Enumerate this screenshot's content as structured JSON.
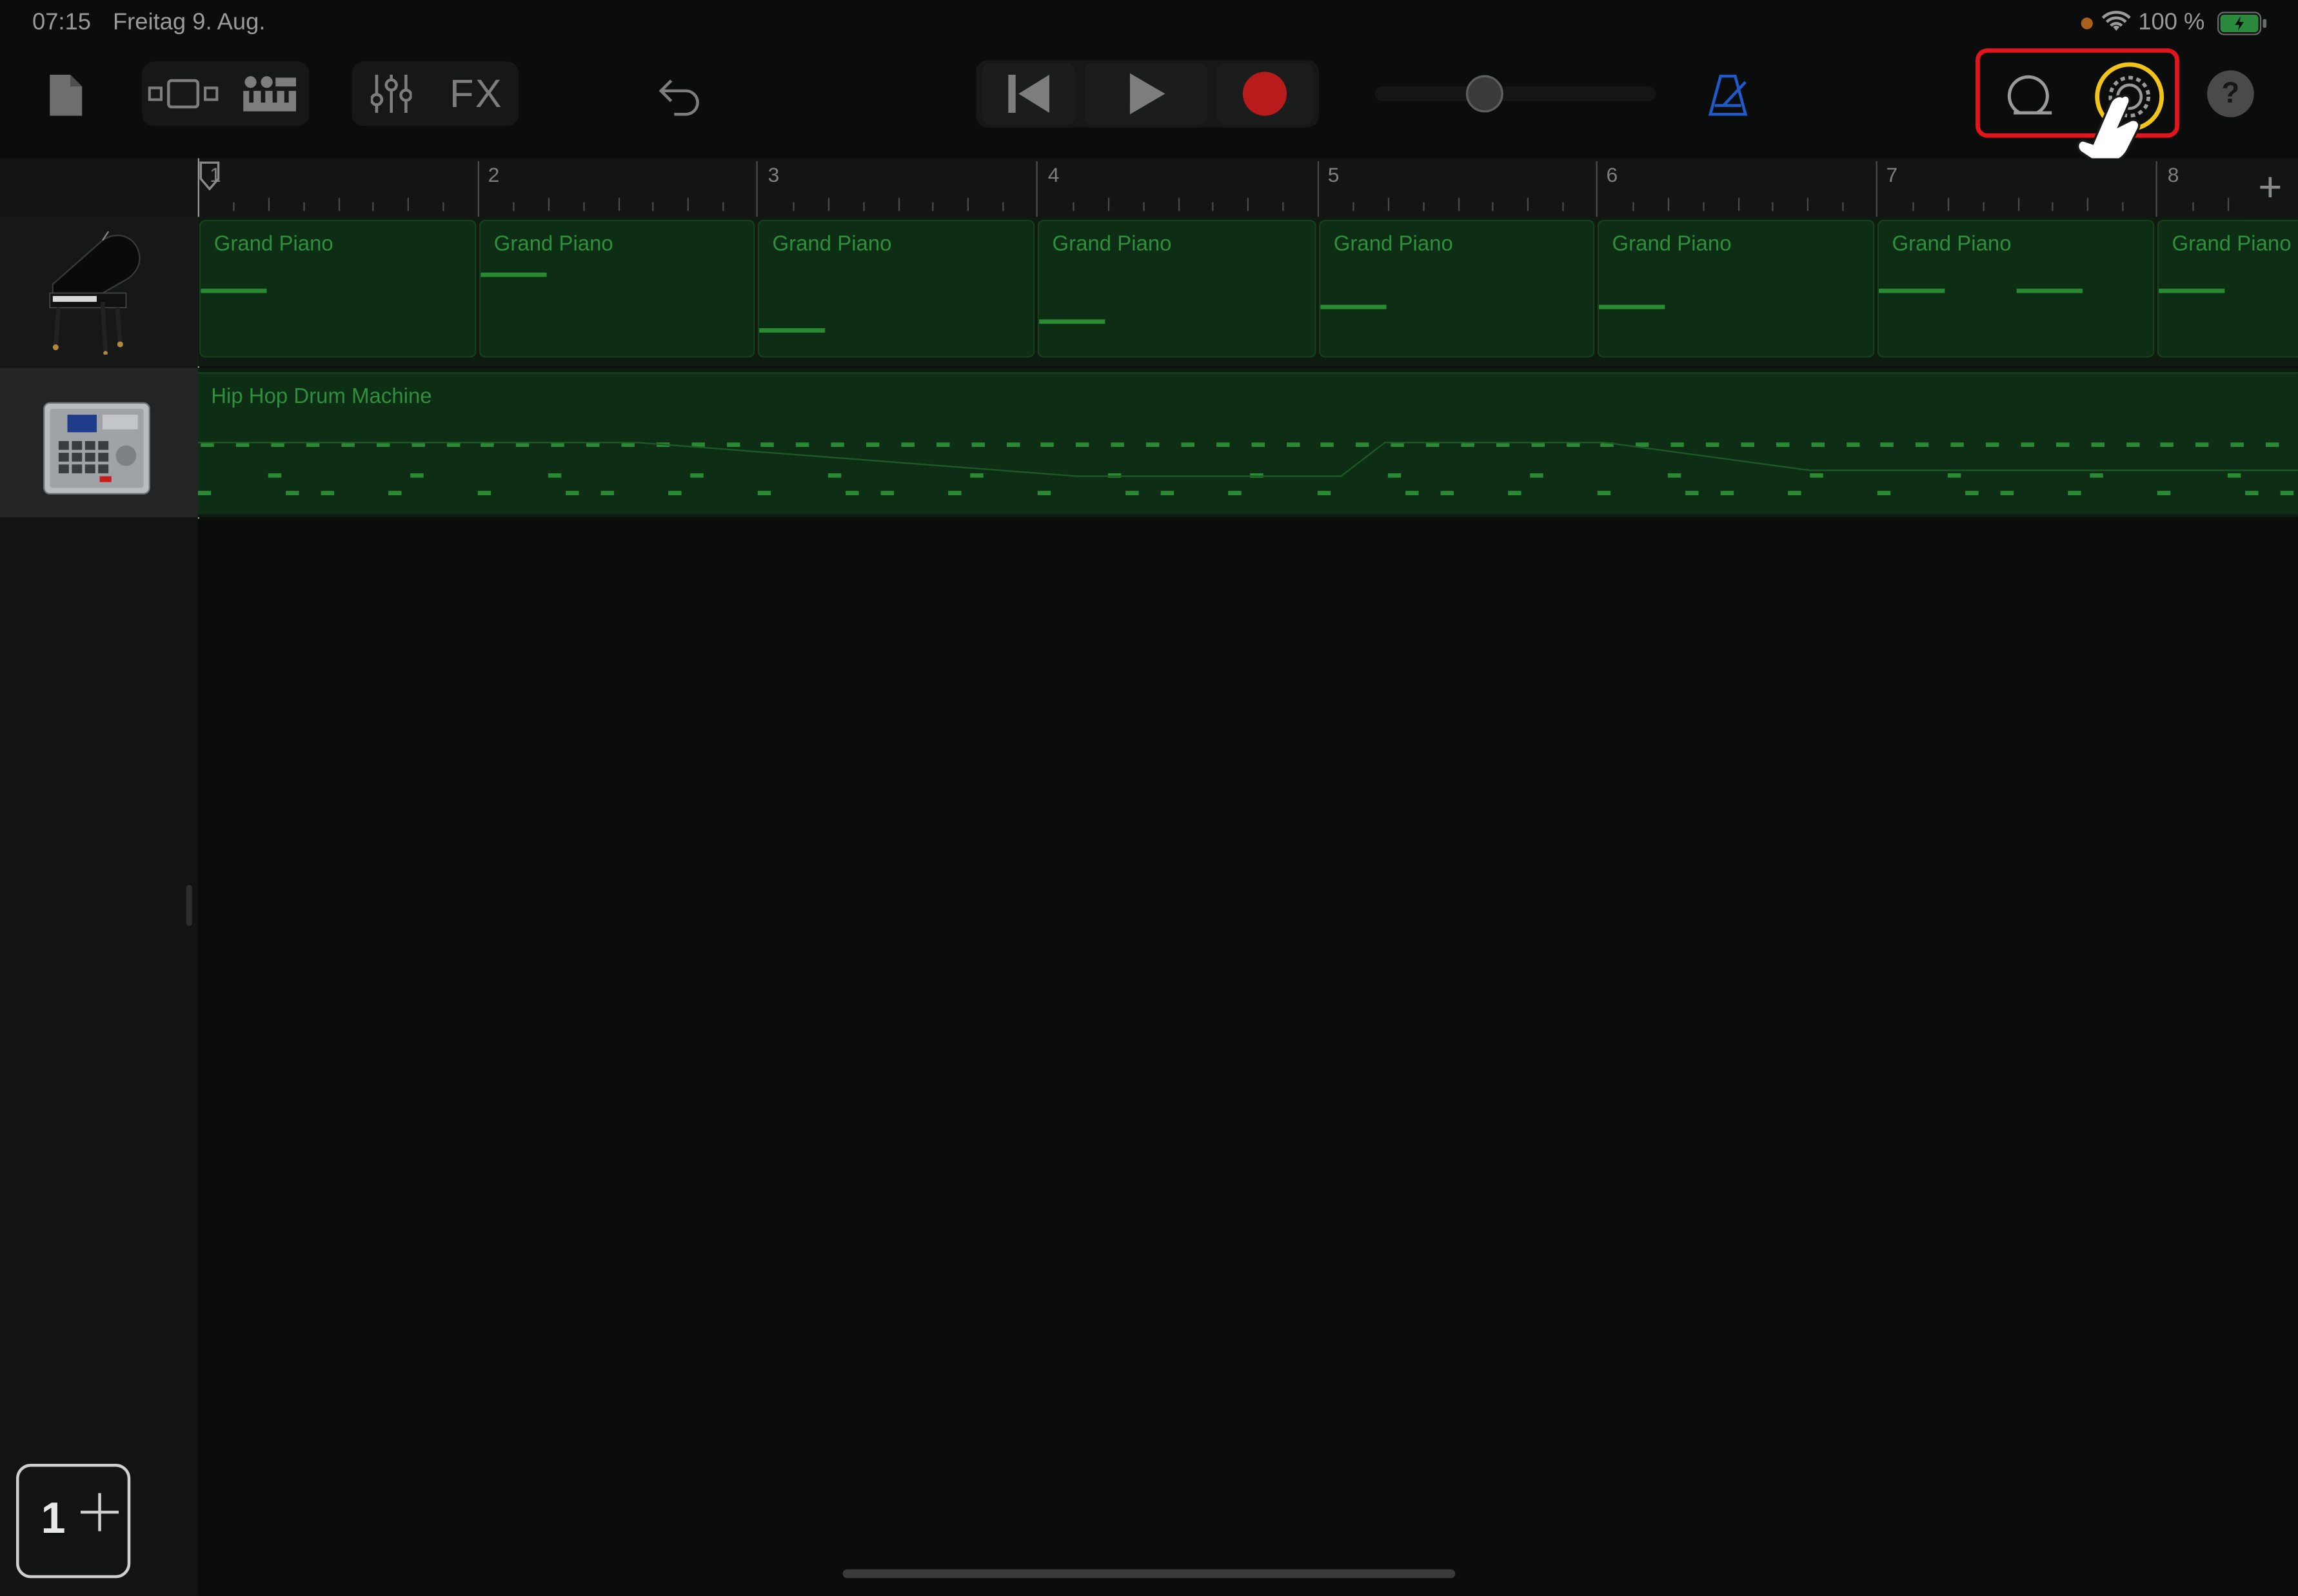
{
  "status_bar": {
    "time": "07:15",
    "date": "Freitag 9. Aug.",
    "battery": "100 %"
  },
  "toolbar": {
    "icons": [
      "document-icon",
      "view-toggle-icon",
      "keyboard-controls-icon",
      "mixer-icon",
      "undo-icon",
      "rewind-icon",
      "play-icon",
      "record-icon",
      "master-volume-slider",
      "metronome-icon",
      "loop-browser-icon",
      "settings-icon",
      "help-icon"
    ],
    "fx_label": "FX",
    "help_label": "?",
    "record_color": "#c81c1c",
    "metronome_color": "#1f5ac8",
    "settings_highlight_color": "#f0c419"
  },
  "ruler": {
    "bars": [
      "1",
      "2",
      "3",
      "4",
      "5",
      "6",
      "7",
      "8"
    ],
    "add_label": "+"
  },
  "tracks": [
    {
      "name": "Grand Piano",
      "instrument_icon": "grand-piano-icon",
      "regions": [
        "Grand Piano",
        "Grand Piano",
        "Grand Piano",
        "Grand Piano",
        "Grand Piano",
        "Grand Piano",
        "Grand Piano",
        "Grand Piano"
      ]
    },
    {
      "name": "Hip Hop Drum Machine",
      "instrument_icon": "drum-machine-icon",
      "regions": [
        "Hip Hop Drum Machine"
      ]
    }
  ],
  "counter": {
    "value": "1"
  },
  "annotation": {
    "highlight_color": "#e3141b",
    "pointer": "hand-pointer-icon"
  }
}
